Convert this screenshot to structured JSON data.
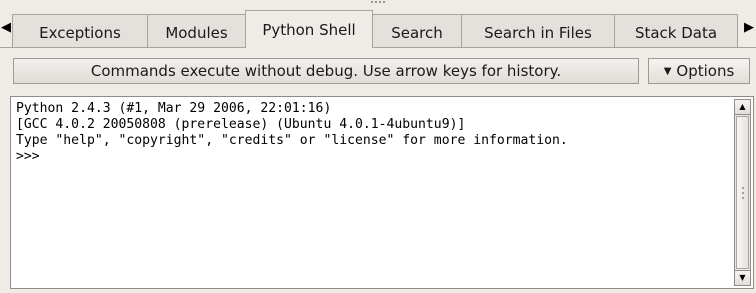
{
  "tabs": [
    {
      "label": "Exceptions",
      "active": false
    },
    {
      "label": "Modules",
      "active": false
    },
    {
      "label": "Python Shell",
      "active": true
    },
    {
      "label": "Search",
      "active": false
    },
    {
      "label": "Search in Files",
      "active": false
    },
    {
      "label": "Stack Data",
      "active": false
    }
  ],
  "tab_scroll": {
    "left_icon": "triangle-left-icon",
    "right_icon": "triangle-right-icon"
  },
  "command_bar": {
    "hint": "Commands execute without debug.  Use arrow keys for history.",
    "options_label": "Options",
    "options_icon": "dropdown-caret-icon"
  },
  "shell": {
    "lines": [
      "Python 2.4.3 (#1, Mar 29 2006, 22:01:16)",
      "[GCC 4.0.2 20050808 (prerelease) (Ubuntu 4.0.1-4ubuntu9)]",
      "Type \"help\", \"copyright\", \"credits\" or \"license\" for more information.",
      ">>>"
    ]
  },
  "colors": {
    "background": "#efebe7",
    "tab_border": "#a7a39e",
    "shell_background": "#ffffff"
  }
}
